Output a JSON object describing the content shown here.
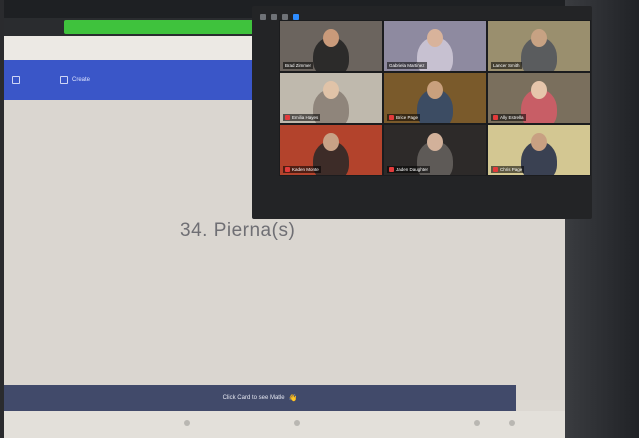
{
  "browser": {
    "bookmarks": [
      "",
      "",
      "",
      "",
      "",
      "",
      "",
      ""
    ]
  },
  "app_bar": {
    "create_label": "Create"
  },
  "slide": {
    "title": "34. Pierna(s)"
  },
  "footer": {
    "text": "Click Card to see Matle",
    "hand_icon": "hand-icon"
  },
  "zoom": {
    "controls": [
      "minimize",
      "gallery-view",
      "speaker-view",
      "fullscreen"
    ],
    "participants": [
      {
        "name": "Brad Zimmer",
        "bg": "#6b645e",
        "shirt": "#2c2b2a",
        "skin": "#c99a7a",
        "muted": false
      },
      {
        "name": "Gabriela Martinez",
        "bg": "#8e8aa0",
        "shirt": "#c7c1d1",
        "skin": "#d8b39b",
        "muted": false
      },
      {
        "name": "Lancer Smith",
        "bg": "#9a8f6e",
        "shirt": "#5a5c5e",
        "skin": "#c7a283",
        "muted": false
      },
      {
        "name": "Emilia Hayes",
        "bg": "#bfb9ad",
        "shirt": "#8f857b",
        "skin": "#e0c3a8",
        "muted": true
      },
      {
        "name": "Brice Page",
        "bg": "#7a5a2b",
        "shirt": "#3c4c63",
        "skin": "#c9a07d",
        "muted": true
      },
      {
        "name": "Ally Estrella",
        "bg": "#7a6f5d",
        "shirt": "#c85e66",
        "skin": "#e6c6ab",
        "muted": true
      },
      {
        "name": "Kaden Monte",
        "bg": "#b3432c",
        "shirt": "#3d2c28",
        "skin": "#c8a286",
        "muted": true
      },
      {
        "name": "Jaden Daughter",
        "bg": "#2d2a29",
        "shirt": "#5e5a57",
        "skin": "#d2b19a",
        "muted": true
      },
      {
        "name": "Chris Page",
        "bg": "#d3c792",
        "shirt": "#3a4152",
        "skin": "#c8a082",
        "muted": true
      }
    ]
  }
}
